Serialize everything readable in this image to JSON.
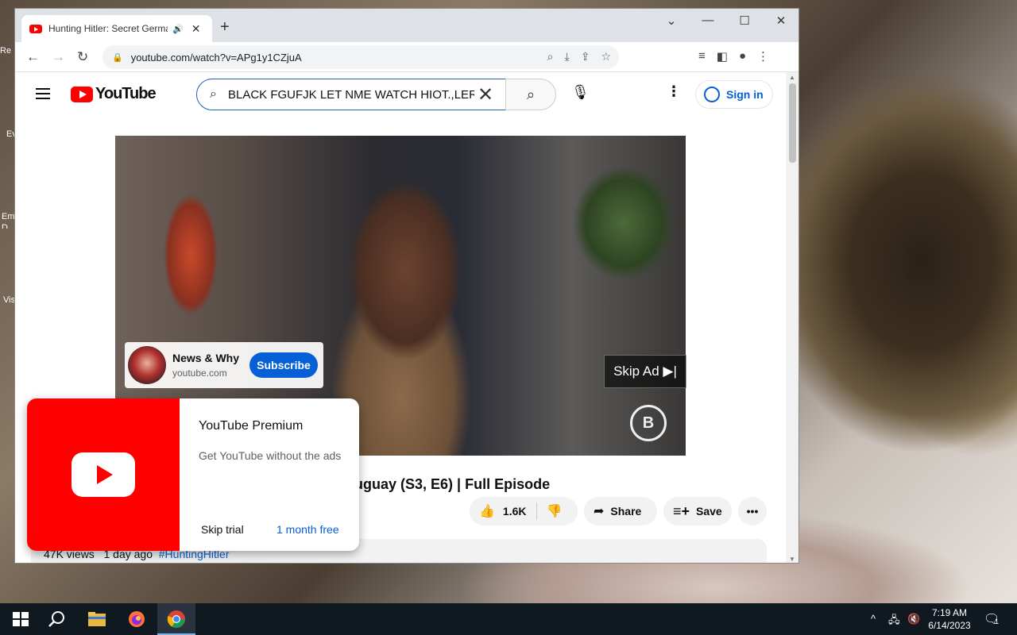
{
  "browser": {
    "tab_title": "Hunting Hitler: Secret Germa",
    "url": "youtube.com/watch?v=APg1y1CZjuA"
  },
  "youtube": {
    "logo_text": "YouTube",
    "search_value": "BLACK FGUFJK LET NME WATCH HIOT.,LER",
    "signin_label": "Sign in"
  },
  "channel_card": {
    "name": "News & Why",
    "domain": "youtube.com",
    "subscribe_label": "Subscribe"
  },
  "player": {
    "skip_ad_label": "Skip Ad ▶|"
  },
  "video": {
    "title_visible": "ruguay (S3, E6) | Full Episode",
    "like_count": "1.6K",
    "share_label": "Share",
    "save_label": "Save",
    "views": "47K views",
    "age": "1 day ago",
    "hashtag": "#HuntingHitler"
  },
  "premium_popup": {
    "title": "YouTube Premium",
    "description": "Get YouTube without the ads",
    "skip_label": "Skip trial",
    "trial_label": "1 month free"
  },
  "taskbar": {
    "time": "7:19 AM",
    "date": "6/14/2023",
    "notification_count": "1"
  },
  "desktop_icons": [
    "Re",
    "Ev",
    "Em D",
    "Vis"
  ]
}
